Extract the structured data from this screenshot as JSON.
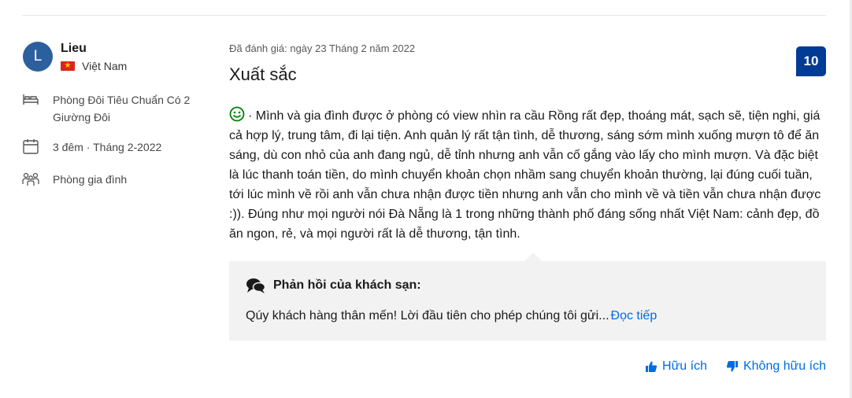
{
  "reviewer": {
    "initial": "L",
    "name": "Lieu",
    "country": "Việt Nam"
  },
  "stay": {
    "room": "Phòng Đôi Tiêu Chuẩn Có 2 Giường Đôi",
    "nights": "3 đêm ·",
    "month": "Tháng 2-2022",
    "traveler_type": "Phòng gia đình"
  },
  "review": {
    "date": "Đã đánh giá: ngày 23 Tháng 2 năm 2022",
    "title": "Xuất sắc",
    "score": "10",
    "body": "· Mình và gia đình được ở phòng có view nhìn ra cầu Rồng rất đẹp, thoáng mát, sạch sẽ, tiện nghi, giá cả hợp lý, trung tâm, đi lại tiện. Anh quản lý rất tận tình, dễ thương, sáng sớm mình xuống mượn tô để ăn sáng, dù con nhỏ của anh đang ngủ, dễ tỉnh nhưng anh vẫn cố gắng vào lấy cho mình mượn. Và đặc biệt là lúc thanh toán tiền, do mình chuyển khoản chọn nhầm sang chuyển khoản thường, lại đúng cuối tuần, tới lúc mình về rồi anh vẫn chưa nhận được tiền nhưng anh vẫn cho mình về và tiền vẫn chưa nhận được :)). Đúng như mọi người nói Đà Nẵng là 1 trong những thành phố đáng sống nhất Việt Nam: cảnh đẹp, đồ ăn ngon, rẻ, và mọi người rất là dễ thương, tận tình."
  },
  "hotel_reply": {
    "header": "Phản hồi của khách sạn:",
    "text": "Qúy khách hàng thân mến! Lời đầu tiên cho phép chúng tôi gửi...",
    "read_more": "Đọc tiếp"
  },
  "actions": {
    "helpful": "Hữu ích",
    "not_helpful": "Không hữu ích"
  },
  "icons": {
    "reply_chat": "chat-bubbles-icon",
    "positive": "smile-icon",
    "helpful": "thumbs-up-icon",
    "not_helpful": "thumbs-down-icon",
    "room": "bed-icon",
    "dates": "calendar-icon",
    "group": "group-icon"
  },
  "colors": {
    "accent": "#006ce4",
    "score_badge": "#003b95",
    "avatar": "#2c5f9e",
    "positive": "#008009",
    "reply_background": "#f2f2f2"
  }
}
